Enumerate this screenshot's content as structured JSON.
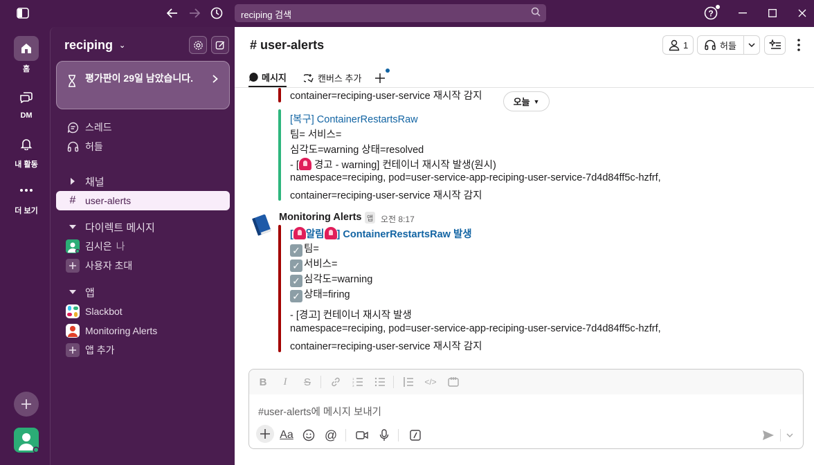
{
  "titlebar": {
    "search_placeholder": "reciping 검색"
  },
  "rail": {
    "items": [
      {
        "label": "홈",
        "icon": "home-icon"
      },
      {
        "label": "DM",
        "icon": "dm-icon"
      },
      {
        "label": "내 활동",
        "icon": "bell-icon"
      },
      {
        "label": "더 보기",
        "icon": "more-icon"
      }
    ]
  },
  "sidebar": {
    "workspace": "reciping",
    "trial_text": "평가판이 29일 남았습니다.",
    "threads": "스레드",
    "huddles": "허들",
    "channels_header": "채널",
    "channel_active": "user-alerts",
    "dm_header": "다이렉트 메시지",
    "dm_user": "김시은",
    "dm_me": "나",
    "invite": "사용자 초대",
    "apps_header": "앱",
    "app1": "Slackbot",
    "app2": "Monitoring Alerts",
    "add_app": "앱 추가"
  },
  "header": {
    "channel": "user-alerts",
    "members_count": "1",
    "huddle": "허들",
    "tab_messages": "메시지",
    "tab_canvas": "캔버스 추가"
  },
  "messages": {
    "day_pill": "오늘",
    "prev_line_top": "container=reciping-user-service 재시작 감지",
    "resolved": {
      "title_prefix": "[복구]",
      "title": "ContainerRestartsRaw",
      "team": "팀= 서비스=",
      "severity": "심각도=warning 상태=resolved",
      "warn_prefix": "- [",
      "warn_suffix": "경고 - warning] 컨테이너 재시작 발생(원시)",
      "ns": " namespace=reciping, pod=user-service-app-reciping-user-service-7d4d84ff5c-hzfrf,",
      "container": "container=reciping-user-service 재시작 감지"
    },
    "alert": {
      "sender": "Monitoring Alerts",
      "badge": "앱",
      "time": "오전 8:17",
      "title_open": "[",
      "title_alarm": "알림",
      "title_close": "]",
      "title_text": "ContainerRestartsRaw 발생",
      "team": "팀=",
      "service": "서비스=",
      "severity": "심각도=warning",
      "status": "상태=firing",
      "warn": "- [경고] 컨테이너 재시작 발생",
      "ns": " namespace=reciping, pod=user-service-app-reciping-user-service-7d4d84ff5c-hzfrf,",
      "container": "container=reciping-user-service 재시작 감지"
    }
  },
  "composer": {
    "placeholder": "#user-alerts에 메시지 보내기"
  },
  "colors": {
    "aubergine": "#481a4d",
    "sidebar": "#4a1d4f",
    "resolved_bar": "#2eb67d",
    "firing_bar": "#a30200",
    "link": "#1264a3"
  }
}
